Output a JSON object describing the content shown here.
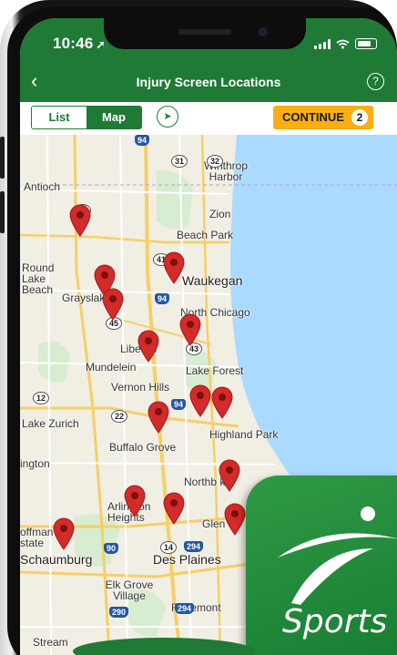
{
  "status": {
    "time": "10:46",
    "location_arrow": "➚"
  },
  "nav": {
    "back_icon": "‹",
    "title": "Injury Screen Locations",
    "help_icon": "?"
  },
  "toolbar": {
    "list_label": "List",
    "map_label": "Map",
    "locate_icon": "➤",
    "continue_label": "CONTINUE",
    "continue_count": "2"
  },
  "map": {
    "labels": {
      "antioch": "Antioch",
      "winthrop_harbor": "Winthrop Harbor",
      "zion": "Zion",
      "beach_park": "Beach Park",
      "round_lake_beach": "Round Lake Beach",
      "grayslake": "Grayslake",
      "waukegan": "Waukegan",
      "north_chicago": "North Chicago",
      "libertyville": "Libe      ille",
      "mundelein": "Mundelein",
      "lake_forest": "Lake Forest",
      "vernon_hills": "Vernon Hills",
      "lake_zurich": "Lake Zurich",
      "highland_park": "Highland Park",
      "buffalo_grove": "Buffalo Grove",
      "ington": "ington",
      "northbrook": "Northb  k",
      "arlington_heights": "Arlington Heights",
      "glenview": "Glen",
      "hoffman_estates": "offman state",
      "schaumburg": "Schaumburg",
      "des_plaines": "Des Plaines",
      "elk_grove": "Elk Grove Village",
      "rosemont": "Rosemont",
      "stream": "Stream"
    },
    "highways": {
      "i94_top": "94",
      "r31": "31",
      "r32": "32",
      "r45_top": "45",
      "r41": "41",
      "i94_mid": "94",
      "r45_mid": "45",
      "r43": "43",
      "r12": "12",
      "r22": "22",
      "i94_low": "94",
      "i90": "90",
      "r14": "14",
      "i294": "294",
      "i290": "290",
      "i294_low": "294"
    }
  },
  "app_icon": {
    "brand_text": "Sports"
  },
  "colors": {
    "brand_green": "#1f7a35",
    "continue_yellow": "#f8ae15",
    "pin_red": "#d32a2a",
    "lake": "#aadaff"
  }
}
